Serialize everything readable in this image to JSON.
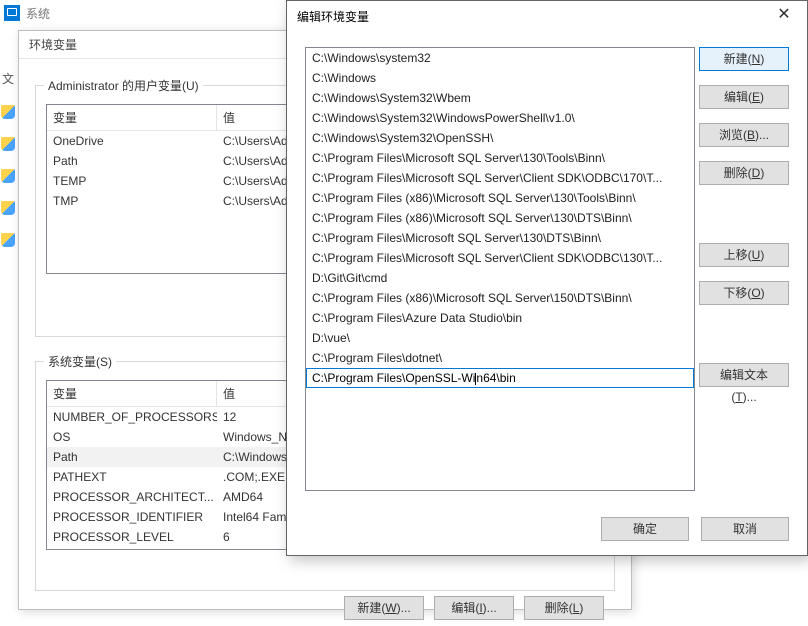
{
  "sys": {
    "title": "系统",
    "menu_text": "文"
  },
  "env": {
    "title": "环境变量",
    "user_legend": "Administrator 的用户变量(U)",
    "sys_legend": "系统变量(S)",
    "col_var": "变量",
    "col_val": "值",
    "user_vars": [
      {
        "name": "OneDrive",
        "value": "C:\\Users\\Ad"
      },
      {
        "name": "Path",
        "value": "C:\\Users\\Ad"
      },
      {
        "name": "TEMP",
        "value": "C:\\Users\\Ad"
      },
      {
        "name": "TMP",
        "value": "C:\\Users\\Ad"
      }
    ],
    "sys_vars": [
      {
        "name": "NUMBER_OF_PROCESSORS",
        "value": "12"
      },
      {
        "name": "OS",
        "value": "Windows_N"
      },
      {
        "name": "Path",
        "value": "C:\\Windows"
      },
      {
        "name": "PATHEXT",
        "value": ".COM;.EXE;"
      },
      {
        "name": "PROCESSOR_ARCHITECT...",
        "value": "AMD64"
      },
      {
        "name": "PROCESSOR_IDENTIFIER",
        "value": "Intel64 Fam"
      },
      {
        "name": "PROCESSOR_LEVEL",
        "value": "6"
      }
    ],
    "sys_selected_index": 2,
    "btn_new": "新建(W)...",
    "btn_edit": "编辑(I)...",
    "btn_del": "删除(L)"
  },
  "edit": {
    "title": "编辑环境变量",
    "paths": [
      "C:\\Windows\\system32",
      "C:\\Windows",
      "C:\\Windows\\System32\\Wbem",
      "C:\\Windows\\System32\\WindowsPowerShell\\v1.0\\",
      "C:\\Windows\\System32\\OpenSSH\\",
      "C:\\Program Files\\Microsoft SQL Server\\130\\Tools\\Binn\\",
      "C:\\Program Files\\Microsoft SQL Server\\Client SDK\\ODBC\\170\\T...",
      "C:\\Program Files (x86)\\Microsoft SQL Server\\130\\Tools\\Binn\\",
      "C:\\Program Files (x86)\\Microsoft SQL Server\\130\\DTS\\Binn\\",
      "C:\\Program Files\\Microsoft SQL Server\\130\\DTS\\Binn\\",
      "C:\\Program Files\\Microsoft SQL Server\\Client SDK\\ODBC\\130\\T...",
      "D:\\Git\\Git\\cmd",
      "C:\\Program Files (x86)\\Microsoft SQL Server\\150\\DTS\\Binn\\",
      "C:\\Program Files\\Azure Data Studio\\bin",
      "D:\\vue\\",
      "C:\\Program Files\\dotnet\\"
    ],
    "selected_value_left": "C:\\Program Files\\OpenSSL-Wi",
    "selected_value_right": "n64\\bin",
    "btn_new": "新建(N)",
    "btn_edit": "编辑(E)",
    "btn_browse": "浏览(B)...",
    "btn_delete": "删除(D)",
    "btn_up": "上移(U)",
    "btn_down": "下移(O)",
    "btn_edit_text": "编辑文本(T)...",
    "btn_ok": "确定",
    "btn_cancel": "取消"
  }
}
